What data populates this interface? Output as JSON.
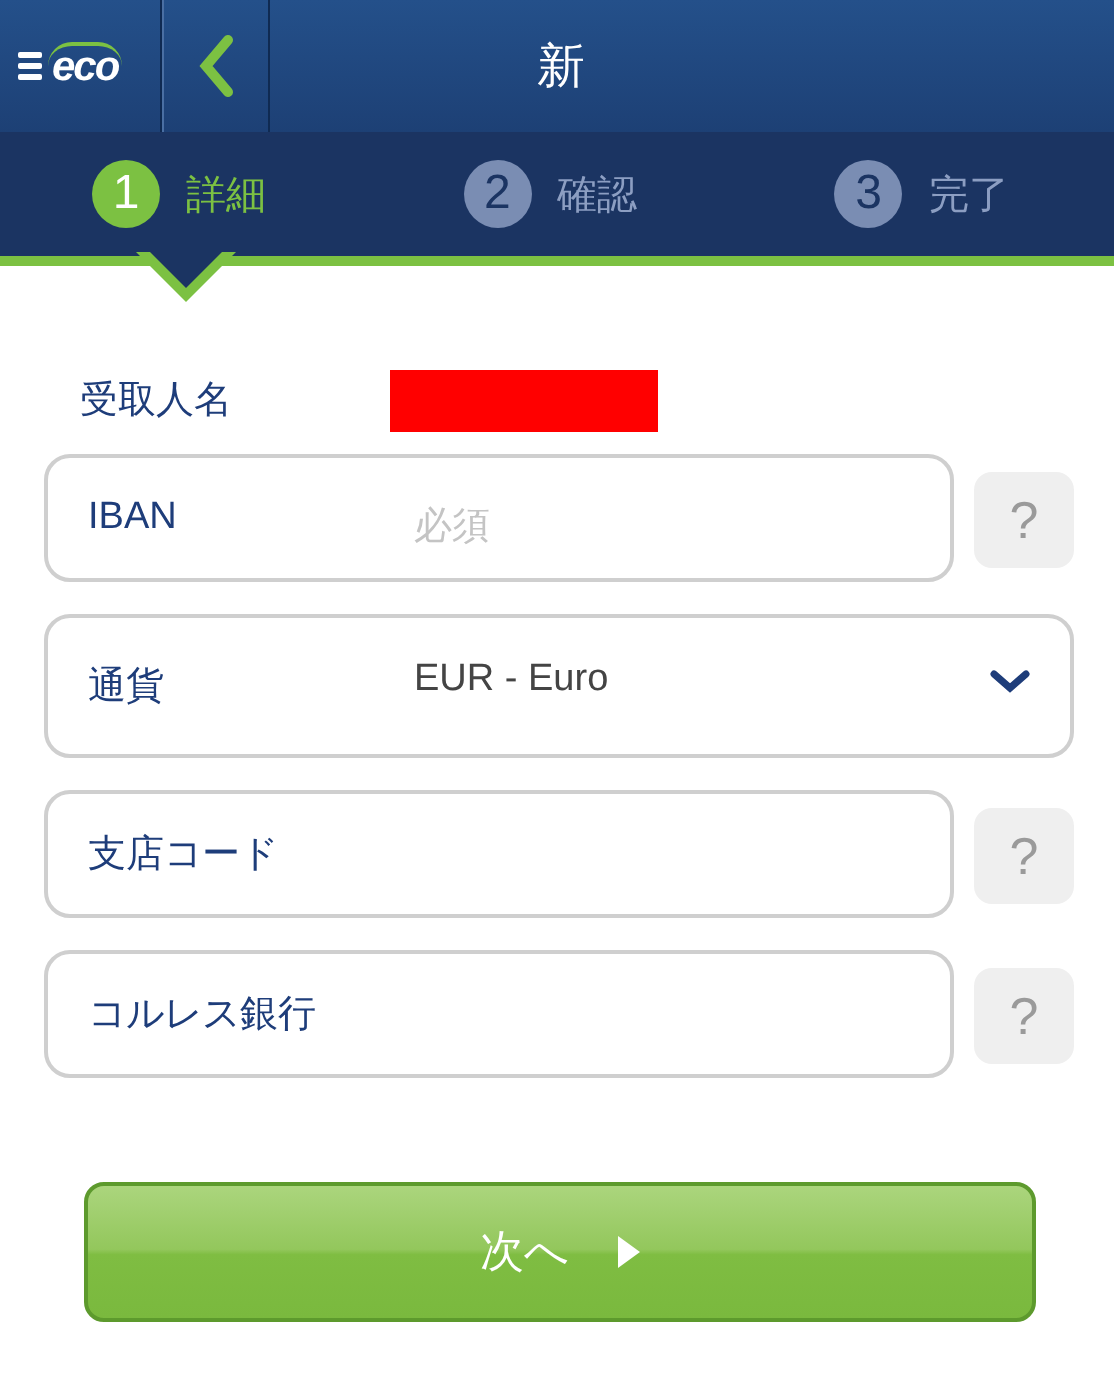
{
  "header": {
    "logo": "eco",
    "title": "新"
  },
  "steps": [
    {
      "number": "1",
      "label": "詳細",
      "selected": true
    },
    {
      "number": "2",
      "label": "確認",
      "selected": false
    },
    {
      "number": "3",
      "label": "完了",
      "selected": false
    }
  ],
  "recipient": {
    "label": "受取人名",
    "redacted": true
  },
  "fields": [
    {
      "kind": "text",
      "label": "IBAN",
      "placeholder": "必須",
      "help": "?"
    },
    {
      "kind": "select",
      "label": "通貨",
      "value": "EUR - Euro"
    },
    {
      "kind": "text",
      "label": "支店コード",
      "help": "?"
    },
    {
      "kind": "text",
      "label": "コルレス銀行",
      "help": "?"
    }
  ],
  "next_button": {
    "label": "次へ"
  }
}
